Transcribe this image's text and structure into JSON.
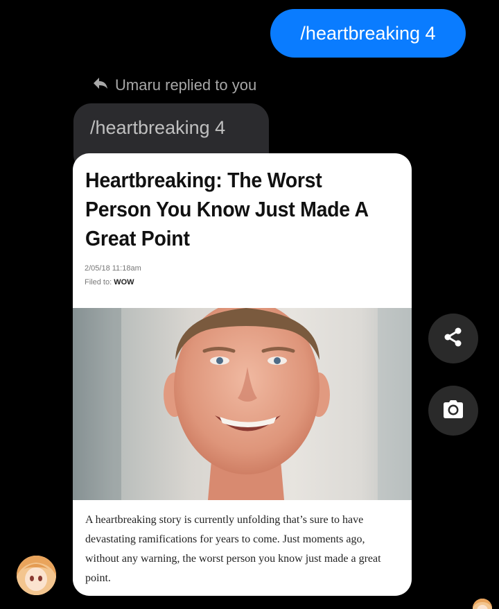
{
  "conversation": {
    "sent_message": "/heartbreaking 4",
    "reply_header": "Umaru replied to you",
    "quoted_message": "/heartbreaking 4"
  },
  "article": {
    "title": "Heartbreaking: The Worst Person You Know Just Made A Great Point",
    "date": "2/05/18 11:18am",
    "filed_label": "Filed to:",
    "filed_tag": "WOW",
    "body": "A heartbreaking story is currently unfolding that’s sure to have devastating ramifications for years to come. Just moments ago, without any warning, the worst person you know just made a great point."
  },
  "actions": {
    "share_icon": "share-icon",
    "camera_icon": "camera-icon"
  },
  "colors": {
    "sent_bubble": "#0a7cff",
    "received_bubble": "#2b2b2e",
    "background": "#000000"
  }
}
